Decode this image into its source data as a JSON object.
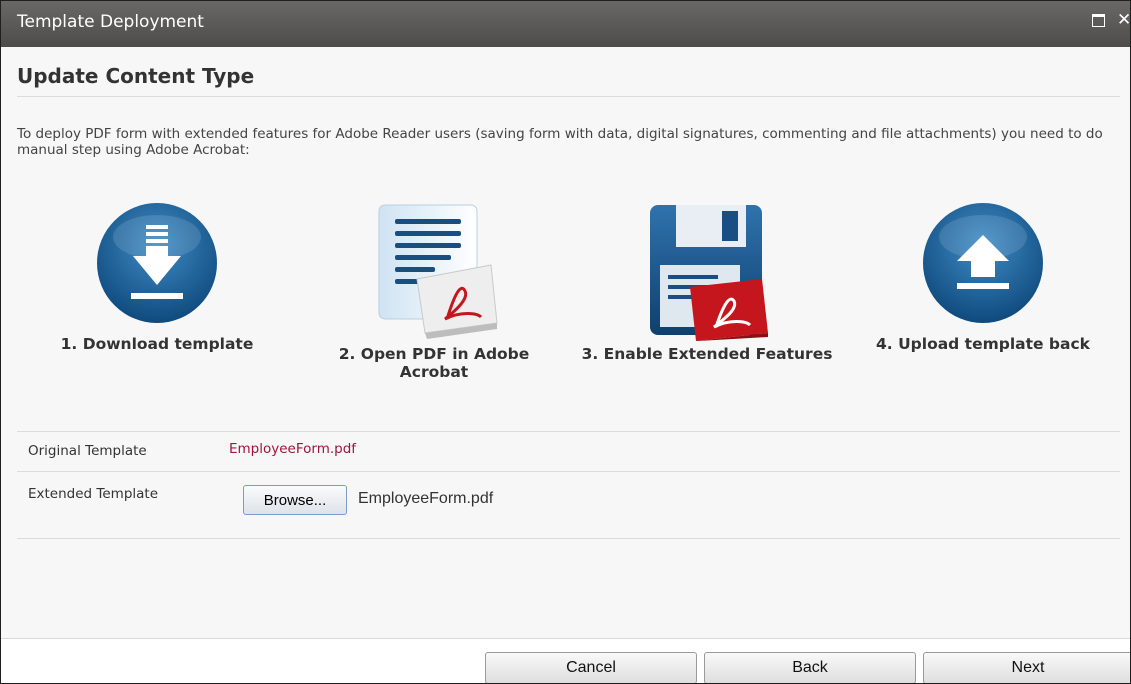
{
  "window": {
    "title": "Template Deployment"
  },
  "page": {
    "heading": "Update Content Type",
    "intro": "To deploy PDF form with extended features for Adobe Reader users (saving form with data, digital signatures, commenting and file attachments) you need to do manual step using Adobe Acrobat:"
  },
  "steps": [
    {
      "label": "1. Download template",
      "icon": "download-icon"
    },
    {
      "label": "2. Open PDF in Adobe Acrobat",
      "icon": "pdf-document-icon"
    },
    {
      "label": "3. Enable Extended Features",
      "icon": "save-pdf-icon"
    },
    {
      "label": "4. Upload template back",
      "icon": "upload-icon"
    }
  ],
  "form": {
    "original_label": "Original Template",
    "original_value": "EmployeeForm.pdf",
    "extended_label": "Extended Template",
    "browse_label": "Browse...",
    "extended_value": "EmployeeForm.pdf"
  },
  "footer": {
    "cancel": "Cancel",
    "back": "Back",
    "next": "Next"
  },
  "colors": {
    "titlebar": "#5a5857",
    "icon_blue": "#1a5c92",
    "pdf_red": "#c4161c",
    "link": "#a0143c"
  }
}
